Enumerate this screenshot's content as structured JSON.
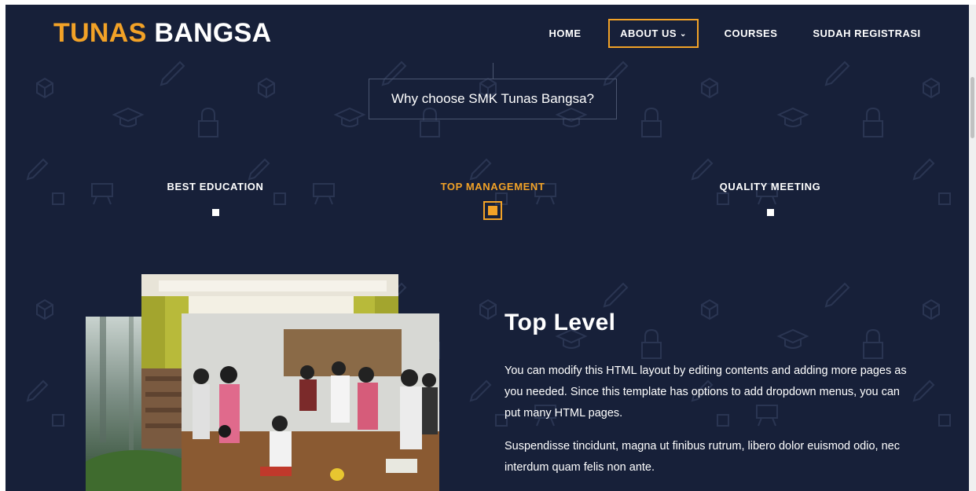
{
  "brand": {
    "part1": "TUNAS",
    "part2": "BANGSA"
  },
  "nav": {
    "home": "HOME",
    "about": "ABOUT US",
    "courses": "COURSES",
    "registrasi": "SUDAH REGISTRASI"
  },
  "section": {
    "heading": "Why choose SMK Tunas Bangsa?"
  },
  "tabs": [
    {
      "label": "BEST EDUCATION",
      "active": false
    },
    {
      "label": "TOP MANAGEMENT",
      "active": true
    },
    {
      "label": "QUALITY MEETING",
      "active": false
    }
  ],
  "content": {
    "title": "Top Level",
    "paragraph1": "You can modify this HTML layout by editing contents and adding more pages as you needed. Since this template has options to add dropdown menus, you can put many HTML pages.",
    "paragraph2": "Suspendisse tincidunt, magna ut finibus rutrum, libero dolor euismod odio, nec interdum quam felis non ante."
  },
  "icons": {
    "about_chevron": "chevron-down-icon"
  },
  "colors": {
    "background": "#172039",
    "accent": "#f2a227",
    "text": "#ffffff",
    "pattern": "#2a3552"
  }
}
